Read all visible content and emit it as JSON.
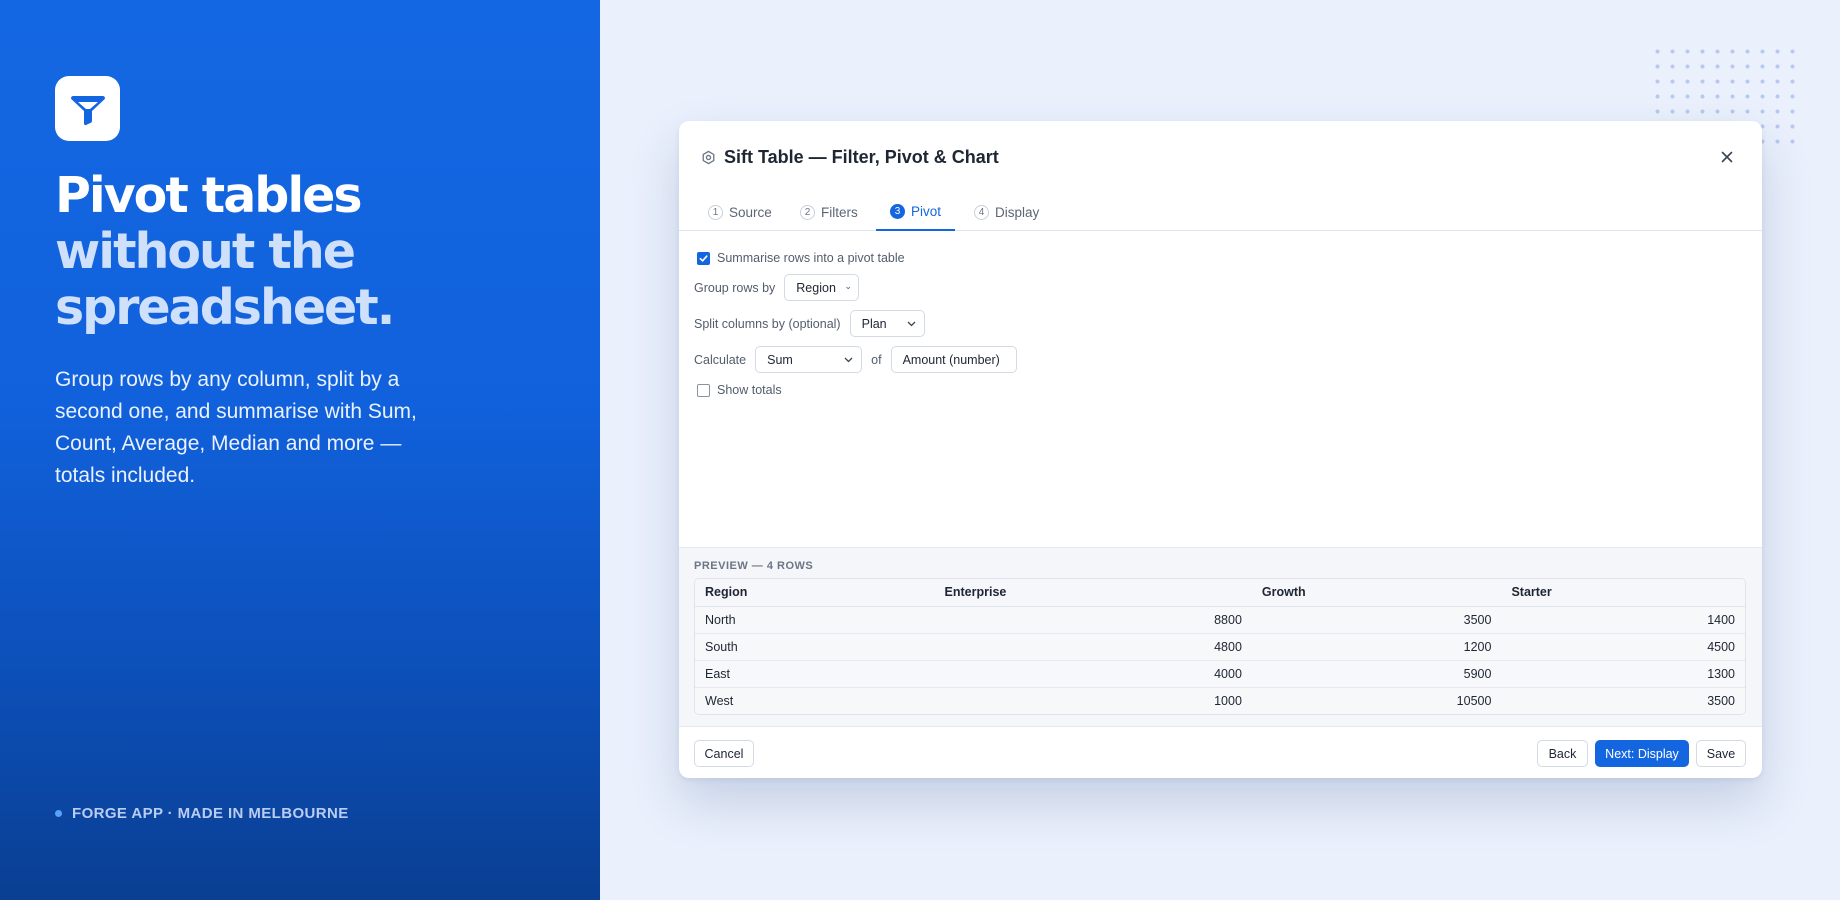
{
  "hero": {
    "headline_line1": "Pivot tables",
    "headline_line2": "without the",
    "headline_line3": "spreadsheet.",
    "subcopy": "Group rows by any column, split by a second one, and summarise with Sum, Count, Average, Median and more — totals included.",
    "footer_note": "FORGE APP · MADE IN MELBOURNE",
    "logo_icon": "funnel-icon"
  },
  "colors": {
    "brand": "#1466e0",
    "hero_gradient_top": "#1467e2",
    "hero_gradient_bottom": "#0a3f92",
    "page_background": "#eaf0fc"
  },
  "dialog": {
    "title": "Sift Table — Filter, Pivot & Chart",
    "title_icon": "gear-icon",
    "close_icon": "close-icon",
    "tabs": [
      {
        "num": "1",
        "label": "Source",
        "active": false
      },
      {
        "num": "2",
        "label": "Filters",
        "active": false
      },
      {
        "num": "3",
        "label": "Pivot",
        "active": true
      },
      {
        "num": "4",
        "label": "Display",
        "active": false
      }
    ],
    "form": {
      "summarise_label": "Summarise rows into a pivot table",
      "summarise_checked": true,
      "group_rows_label": "Group rows by",
      "group_rows_value": "Region",
      "split_columns_label": "Split columns by (optional)",
      "split_columns_value": "Plan",
      "calculate_label": "Calculate",
      "calculate_value": "Sum",
      "of_label": "of",
      "field_value": "Amount (number)",
      "show_totals_label": "Show totals",
      "show_totals_checked": false
    },
    "preview": {
      "label": "PREVIEW — 4 ROWS",
      "columns": [
        "Region",
        "Enterprise",
        "Growth",
        "Starter"
      ],
      "rows": [
        [
          "North",
          "8800",
          "3500",
          "1400"
        ],
        [
          "South",
          "4800",
          "1200",
          "4500"
        ],
        [
          "East",
          "4000",
          "5900",
          "1300"
        ],
        [
          "West",
          "1000",
          "10500",
          "3500"
        ]
      ]
    },
    "footer": {
      "cancel": "Cancel",
      "back": "Back",
      "next": "Next: Display",
      "save": "Save"
    }
  }
}
